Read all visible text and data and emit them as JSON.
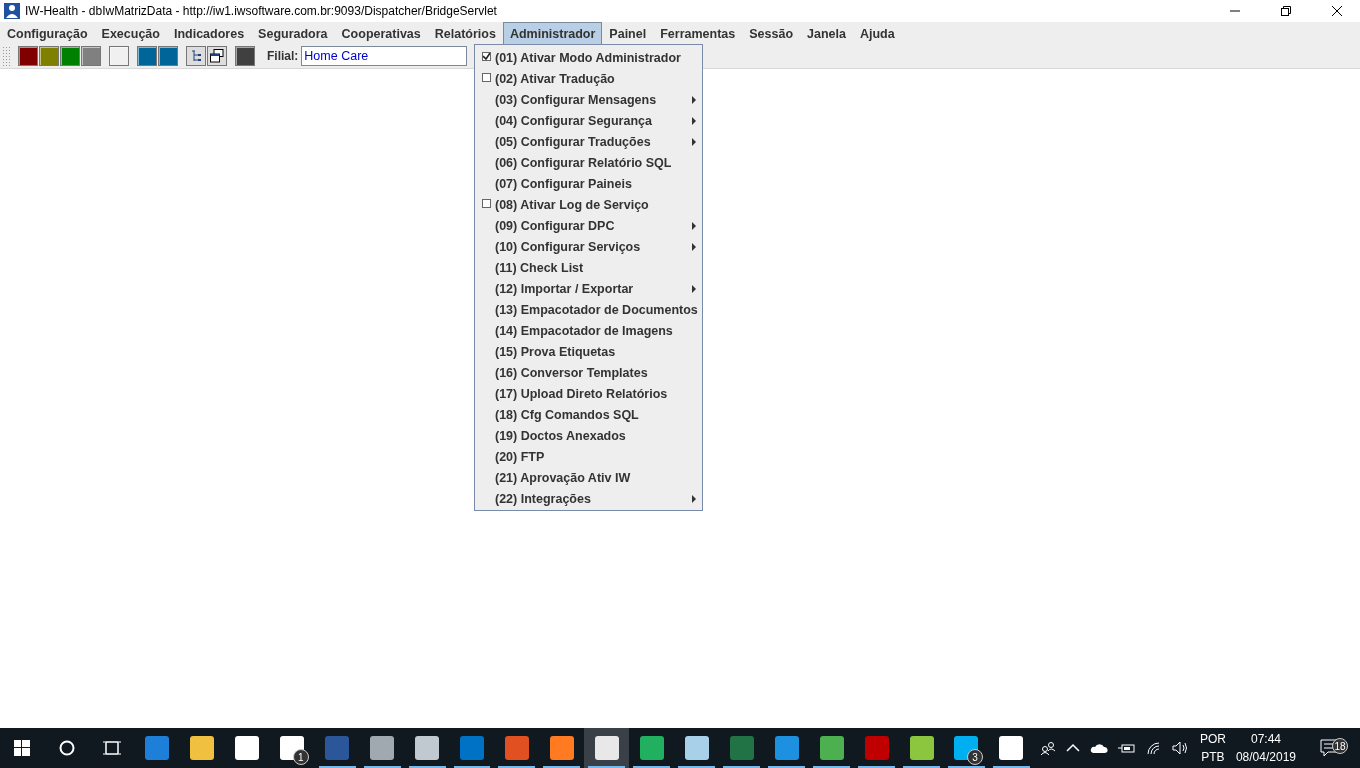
{
  "window": {
    "title": "IW-Health - dbIwMatrizData - http://iw1.iwsoftware.com.br:9093/Dispatcher/BridgeServlet"
  },
  "menubar": [
    {
      "label": "Configuração",
      "selected": false
    },
    {
      "label": "Execução",
      "selected": false
    },
    {
      "label": "Indicadores",
      "selected": false
    },
    {
      "label": "Seguradora",
      "selected": false
    },
    {
      "label": "Cooperativas",
      "selected": false
    },
    {
      "label": "Relatórios",
      "selected": false
    },
    {
      "label": "Administrador",
      "selected": true
    },
    {
      "label": "Painel",
      "selected": false
    },
    {
      "label": "Ferramentas",
      "selected": false
    },
    {
      "label": "Sessão",
      "selected": false
    },
    {
      "label": "Janela",
      "selected": false
    },
    {
      "label": "Ajuda",
      "selected": false
    }
  ],
  "toolbar": {
    "groups": [
      [
        {
          "kind": "swatch",
          "color": "#800000"
        },
        {
          "kind": "swatch",
          "color": "#808000"
        },
        {
          "kind": "swatch",
          "color": "#008000"
        },
        {
          "kind": "swatch",
          "color": "#808080"
        }
      ],
      [
        {
          "kind": "swatch",
          "color": "#f0f0f0"
        }
      ],
      [
        {
          "kind": "swatch",
          "color": "#006699"
        },
        {
          "kind": "swatch",
          "color": "#006699"
        }
      ],
      [
        {
          "kind": "tree"
        },
        {
          "kind": "windows"
        }
      ],
      [
        {
          "kind": "swatch",
          "color": "#404040"
        }
      ]
    ],
    "filial_label": "Filial:",
    "filial_value": "Home Care"
  },
  "menu": [
    {
      "label": "(01) Ativar Modo Administrador",
      "kind": "check",
      "checked": true
    },
    {
      "label": "(02) Ativar Tradução",
      "kind": "check",
      "checked": false
    },
    {
      "label": "(03) Configurar Mensagens",
      "kind": "submenu"
    },
    {
      "label": "(04) Configurar Segurança",
      "kind": "submenu"
    },
    {
      "label": "(05) Configurar Traduções",
      "kind": "submenu"
    },
    {
      "label": "(06) Configurar Relatório SQL",
      "kind": "plain"
    },
    {
      "label": "(07) Configurar Paineis",
      "kind": "plain"
    },
    {
      "label": "(08) Ativar Log de Serviço",
      "kind": "check",
      "checked": false
    },
    {
      "label": "(09) Configurar DPC",
      "kind": "submenu"
    },
    {
      "label": "(10) Configurar Serviços",
      "kind": "submenu"
    },
    {
      "label": "(11) Check List",
      "kind": "plain"
    },
    {
      "label": "(12) Importar / Exportar",
      "kind": "submenu"
    },
    {
      "label": "(13) Empacotador de Documentos",
      "kind": "plain"
    },
    {
      "label": "(14) Empacotador de Imagens",
      "kind": "plain"
    },
    {
      "label": "(15) Prova Etiquetas",
      "kind": "plain"
    },
    {
      "label": "(16) Conversor Templates",
      "kind": "plain"
    },
    {
      "label": "(17) Upload Direto Relatórios",
      "kind": "plain"
    },
    {
      "label": "(18) Cfg Comandos SQL",
      "kind": "plain"
    },
    {
      "label": "(19) Doctos Anexados",
      "kind": "plain"
    },
    {
      "label": "(20) FTP",
      "kind": "plain"
    },
    {
      "label": "(21) Aprovação Ativ IW",
      "kind": "plain"
    },
    {
      "label": "(22) Integrações",
      "kind": "submenu"
    }
  ],
  "taskbar": {
    "apps": [
      {
        "color": "#1e7fd8",
        "running": false,
        "active": false
      },
      {
        "color": "#f0c040",
        "running": false,
        "active": false
      },
      {
        "color": "#ffffff",
        "running": false,
        "active": false
      },
      {
        "color": "#ffffff",
        "running": false,
        "active": false,
        "badge": "1"
      },
      {
        "color": "#2b579a",
        "running": true,
        "active": false
      },
      {
        "color": "#a0a8b0",
        "running": true,
        "active": false
      },
      {
        "color": "#c0c8d0",
        "running": true,
        "active": false
      },
      {
        "color": "#0072c6",
        "running": true,
        "active": false
      },
      {
        "color": "#e05020",
        "running": true,
        "active": false
      },
      {
        "color": "#ff7a20",
        "running": true,
        "active": false
      },
      {
        "color": "#e8e8e8",
        "running": true,
        "active": true
      },
      {
        "color": "#20b060",
        "running": true,
        "active": false
      },
      {
        "color": "#a8d0e8",
        "running": true,
        "active": false
      },
      {
        "color": "#217346",
        "running": true,
        "active": false
      },
      {
        "color": "#1e90e0",
        "running": true,
        "active": false
      },
      {
        "color": "#4caf50",
        "running": true,
        "active": false
      },
      {
        "color": "#c00000",
        "running": true,
        "active": false
      },
      {
        "color": "#8cc63f",
        "running": true,
        "active": false
      },
      {
        "color": "#00aff0",
        "running": true,
        "active": false,
        "badge": "3"
      },
      {
        "color": "#ffffff",
        "running": true,
        "active": false
      }
    ],
    "lang_top": "POR",
    "lang_bottom": "PTB",
    "time": "07:44",
    "date": "08/04/2019",
    "notifications": "18"
  }
}
